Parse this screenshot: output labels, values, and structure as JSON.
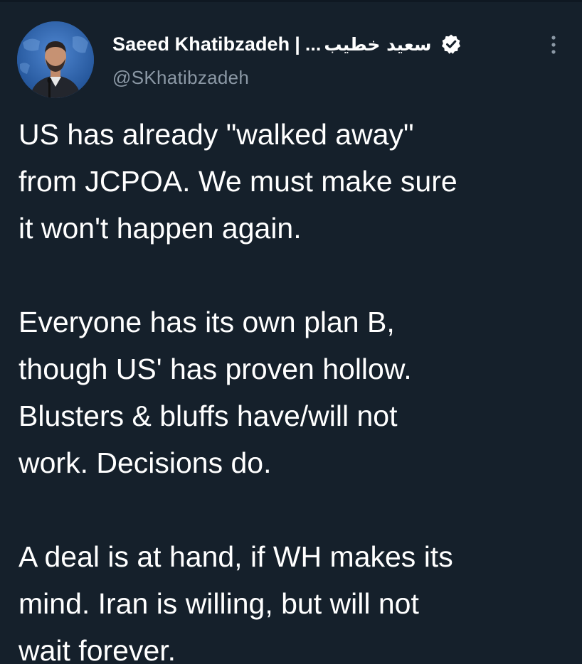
{
  "author": {
    "display_name": "Saeed Khatibzadeh",
    "separator": "|",
    "ellipsis": "...",
    "display_name_arabic": "سعيد خطيب",
    "handle": "@SKhatibzadeh",
    "verified": true,
    "avatar_icon": "profile-photo"
  },
  "icons": {
    "verified": "verified-badge-icon",
    "more": "more-options-icon"
  },
  "colors": {
    "background": "#15202b",
    "text": "#ffffff",
    "secondary_text": "#8b98a5"
  },
  "tweet": {
    "paragraphs": [
      {
        "lines": [
          "US has already \"walked away\"",
          "from JCPOA. We must make sure",
          "it won't happen again."
        ]
      },
      {
        "lines": [
          "Everyone has its own plan B,",
          "though US' has proven hollow.",
          "Blusters & bluffs have/will not",
          "work. Decisions do."
        ]
      },
      {
        "lines": [
          "A deal is at hand, if WH makes its",
          "mind. Iran is willing, but will not",
          "wait forever."
        ]
      }
    ]
  }
}
